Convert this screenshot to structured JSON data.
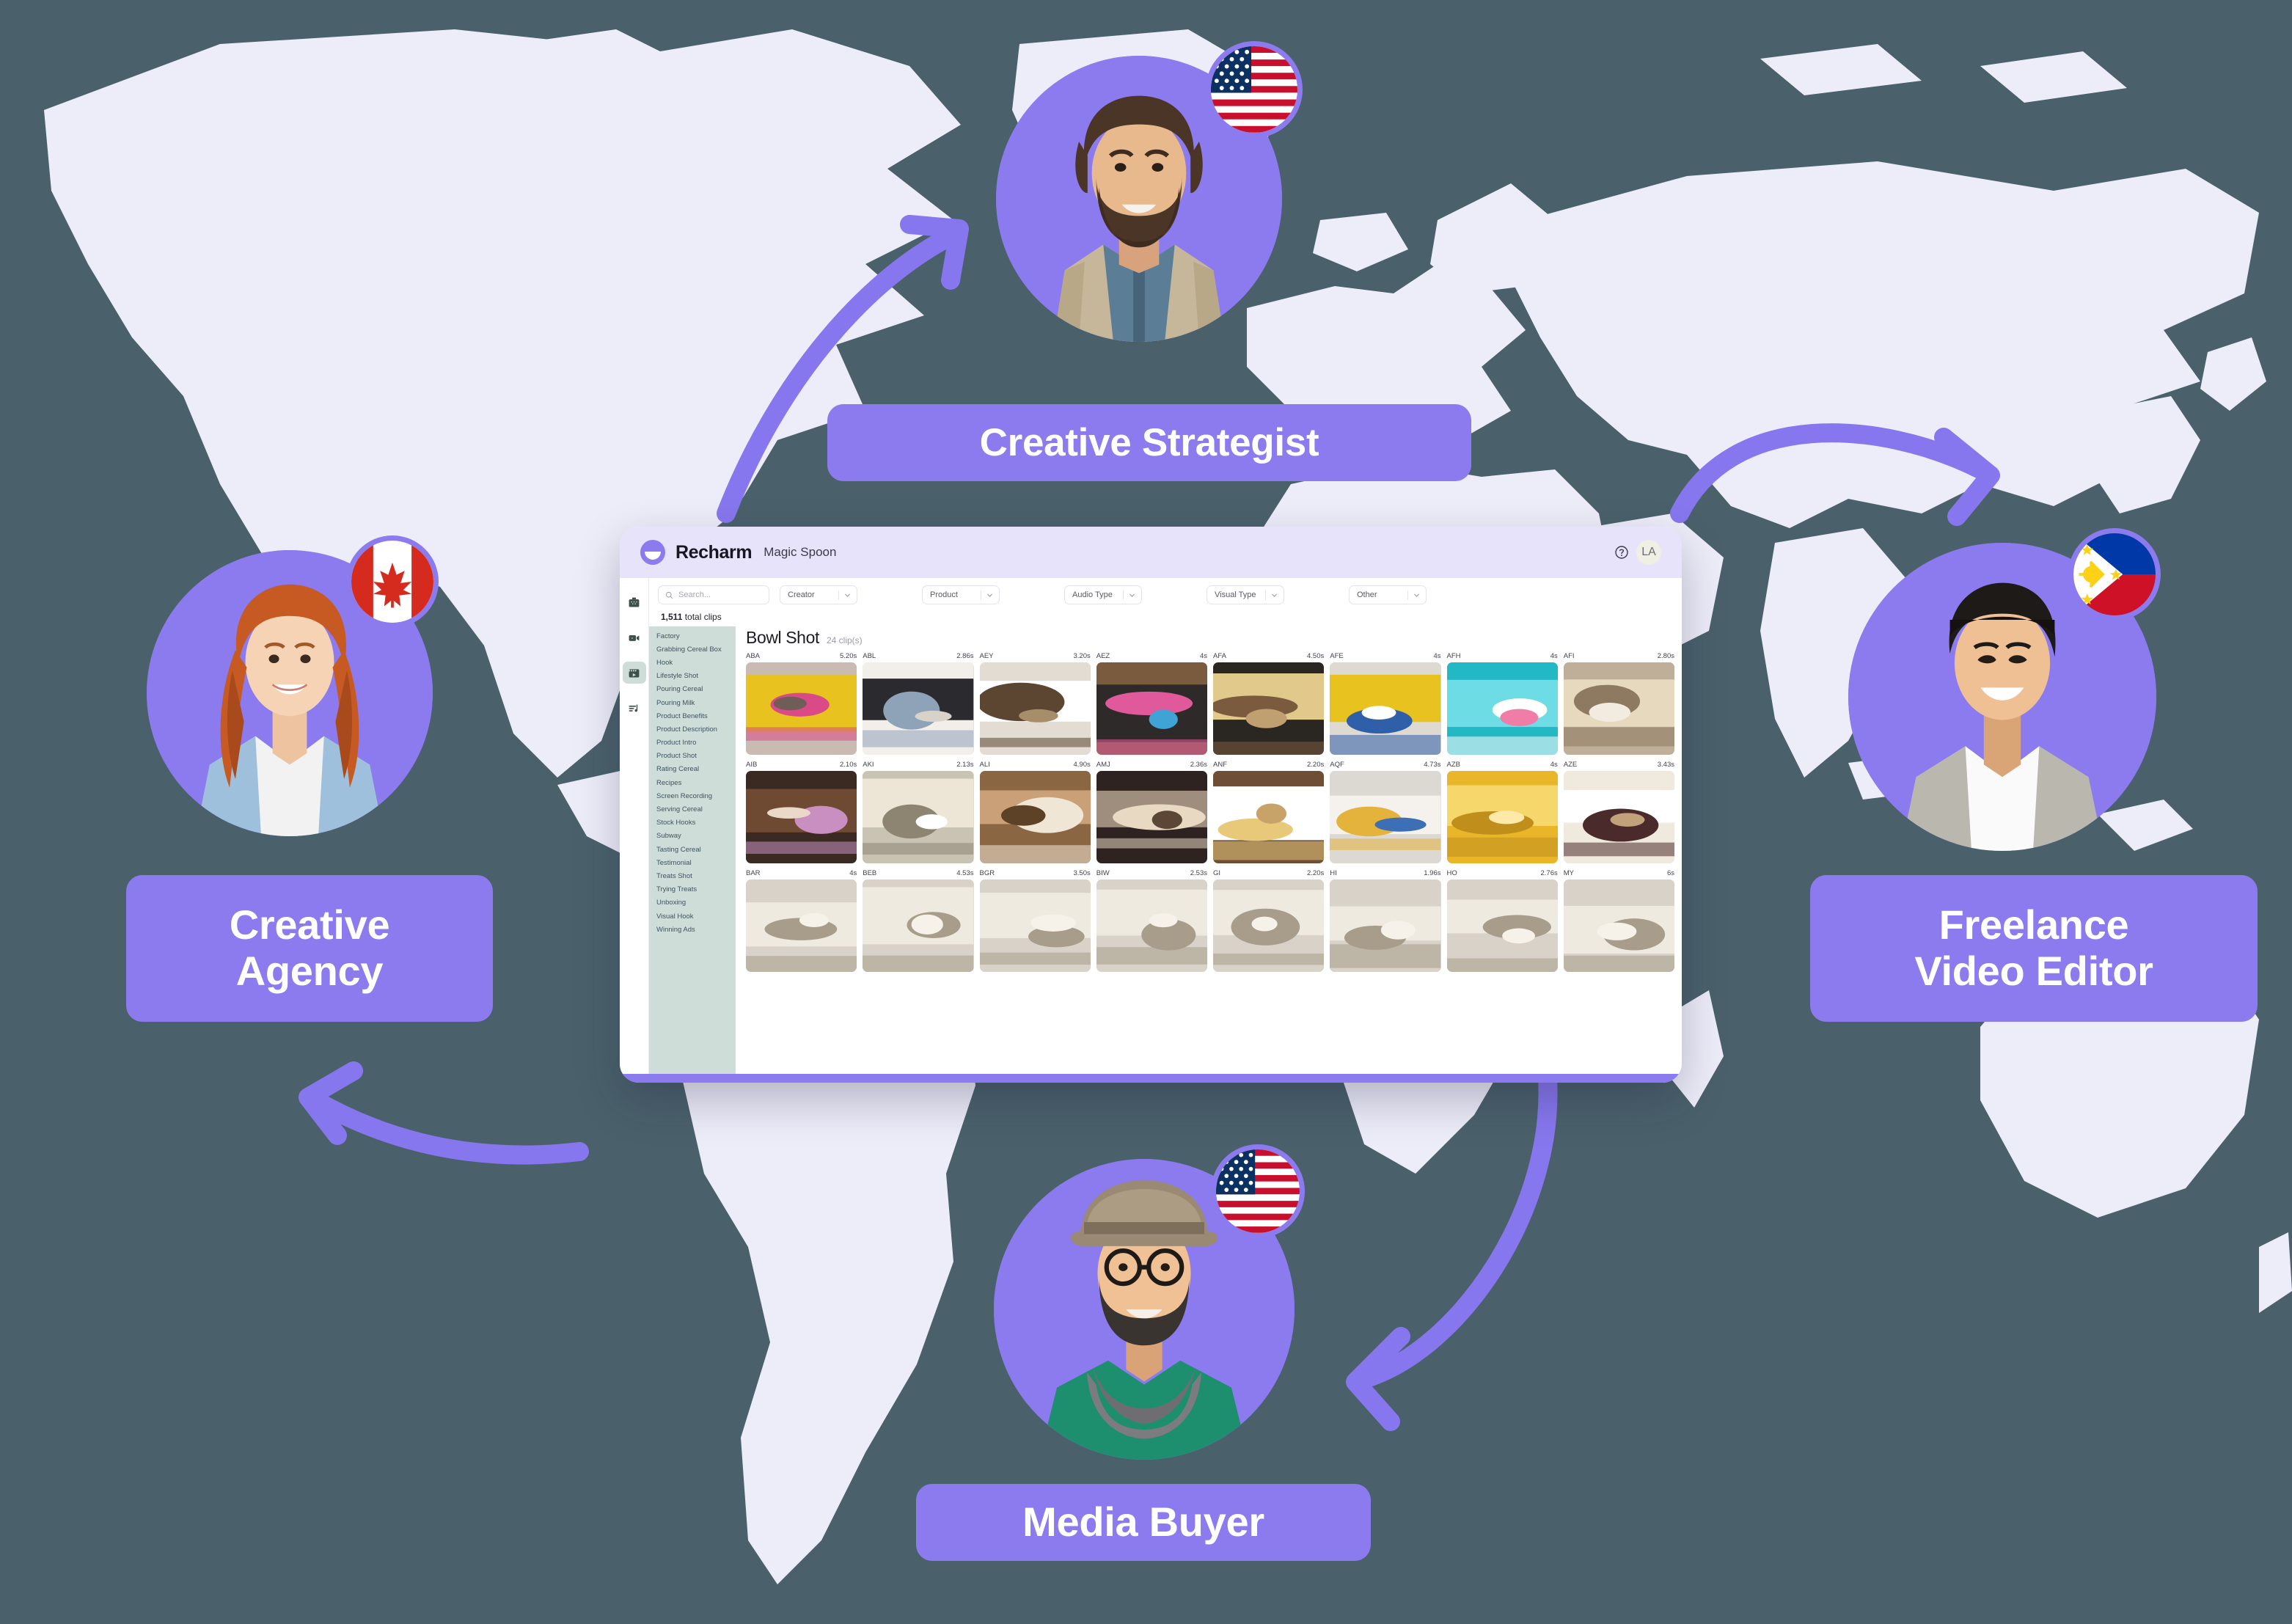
{
  "scene": {
    "background_color": "#4A616B",
    "land_color": "#EDEDF9",
    "accent_purple": "#8B7BEE",
    "arrow_color": "#8777EE"
  },
  "nodes": [
    {
      "id": "creative-strategist",
      "label": "Creative Strategist",
      "flag": "us-flag-icon",
      "flag_name": "United States"
    },
    {
      "id": "creative-agency",
      "label": "Creative\nAgency",
      "flag": "ca-flag-icon",
      "flag_name": "Canada"
    },
    {
      "id": "freelance-video-editor",
      "label": "Freelance\nVideo Editor",
      "flag": "ph-flag-icon",
      "flag_name": "Philippines"
    },
    {
      "id": "media-buyer",
      "label": "Media Buyer",
      "flag": "us-flag-icon",
      "flag_name": "United States"
    }
  ],
  "app": {
    "brand": "Recharm",
    "workspace": "Magic Spoon",
    "help_icon": "question-circle-icon",
    "user_initials": "LA",
    "rail": [
      {
        "name": "briefcase-icon",
        "active": false
      },
      {
        "name": "video-camera-icon",
        "active": false
      },
      {
        "name": "film-clapper-icon",
        "active": true
      },
      {
        "name": "audio-list-icon",
        "active": false
      }
    ],
    "filters": {
      "search_placeholder": "Search...",
      "search_icon": "search-icon",
      "selects": [
        {
          "label": "Creator"
        },
        {
          "label": "Product"
        },
        {
          "label": "Audio Type"
        },
        {
          "label": "Visual Type"
        },
        {
          "label": "Other"
        }
      ]
    },
    "total_clips_count": "1,511",
    "total_clips_suffix": " total clips",
    "categories": [
      "Factory",
      "Grabbing Cereal Box",
      "Hook",
      "Lifestyle Shot",
      "Pouring Cereal",
      "Pouring Milk",
      "Product Benefits",
      "Product Description",
      "Product Intro",
      "Product Shot",
      "Rating Cereal",
      "Recipes",
      "Screen Recording",
      "Serving Cereal",
      "Stock Hooks",
      "Subway",
      "Tasting Cereal",
      "Testimonial",
      "Treats Shot",
      "Trying Treats",
      "Unboxing",
      "Visual Hook",
      "Winning Ads"
    ],
    "grid": {
      "title": "Bowl Shot",
      "count_label": "24 clip(s)",
      "clips": [
        {
          "code": "ABA",
          "duration": "5.20s",
          "art": "cereal-box-yellow"
        },
        {
          "code": "ABL",
          "duration": "2.86s",
          "art": "laptop-desk"
        },
        {
          "code": "AEY",
          "duration": "3.20s",
          "art": "bowl-white-table"
        },
        {
          "code": "AEZ",
          "duration": "4s",
          "art": "bowl-colorful-box"
        },
        {
          "code": "AFA",
          "duration": "4.50s",
          "art": "hand-bowl-dark"
        },
        {
          "code": "AFE",
          "duration": "4s",
          "art": "cereal-box-hand"
        },
        {
          "code": "AFH",
          "duration": "4s",
          "art": "teal-pouch"
        },
        {
          "code": "AFI",
          "duration": "2.80s",
          "art": "bowl-cereal-hands"
        },
        {
          "code": "AIB",
          "duration": "2.10s",
          "art": "chocolate-bowl"
        },
        {
          "code": "AKI",
          "duration": "2.13s",
          "art": "kitchen-counter"
        },
        {
          "code": "ALI",
          "duration": "4.90s",
          "art": "bowl-wood-table"
        },
        {
          "code": "AMJ",
          "duration": "2.36s",
          "art": "spoon-box-dark"
        },
        {
          "code": "ANF",
          "duration": "2.20s",
          "art": "white-bowl-spoon"
        },
        {
          "code": "AQF",
          "duration": "4.73s",
          "art": "box-marble-counter"
        },
        {
          "code": "AZB",
          "duration": "4s",
          "art": "yellow-cereal-pile"
        },
        {
          "code": "AZE",
          "duration": "3.43s",
          "art": "bowl-berries"
        },
        {
          "code": "BAR",
          "duration": "4s",
          "art": "row3"
        },
        {
          "code": "BEB",
          "duration": "4.53s",
          "art": "row3"
        },
        {
          "code": "BGR",
          "duration": "3.50s",
          "art": "row3"
        },
        {
          "code": "BIW",
          "duration": "2.53s",
          "art": "row3"
        },
        {
          "code": "GI",
          "duration": "2.20s",
          "art": "row3"
        },
        {
          "code": "HI",
          "duration": "1.96s",
          "art": "row3"
        },
        {
          "code": "HO",
          "duration": "2.76s",
          "art": "row3"
        },
        {
          "code": "MY",
          "duration": "6s",
          "art": "row3"
        }
      ]
    }
  }
}
